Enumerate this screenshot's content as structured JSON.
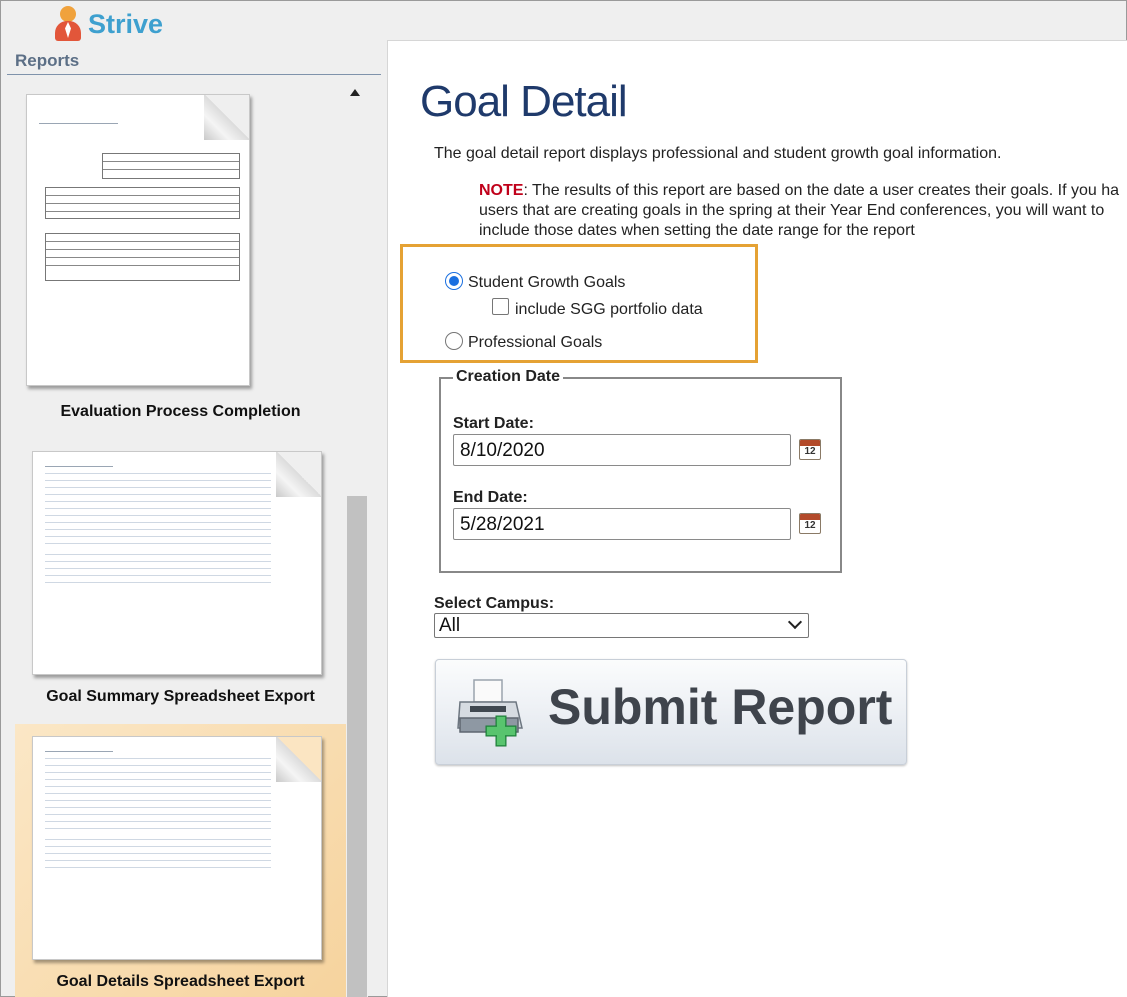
{
  "brand": {
    "name": "Strive"
  },
  "sidebar": {
    "title": "Reports",
    "reports": [
      {
        "label": "Evaluation Process Completion",
        "selected": false
      },
      {
        "label": "Goal Summary Spreadsheet Export",
        "selected": false
      },
      {
        "label": "Goal Details Spreadsheet Export",
        "selected": true
      }
    ]
  },
  "main": {
    "title": "Goal Detail",
    "description": "The goal detail report displays professional and student growth goal information.",
    "note": {
      "label": "NOTE",
      "lines": [
        ": The results of this report are based on the date a user creates their goals. If you ha",
        "users that are creating goals in the spring at their Year End conferences, you will want to",
        "include those dates when setting the date range for the report"
      ]
    },
    "goal_options": {
      "student_growth": "Student Growth Goals",
      "include_portfolio": "include SGG portfolio data",
      "professional": "Professional Goals",
      "selected": "student_growth",
      "include_portfolio_checked": false
    },
    "creation_date": {
      "legend": "Creation Date",
      "start_label": "Start Date:",
      "start_value": "8/10/2020",
      "end_label": "End Date:",
      "end_value": "5/28/2021",
      "calendar_day": "12"
    },
    "campus": {
      "label": "Select Campus:",
      "selected": "All"
    },
    "submit": {
      "label": "Submit Report"
    }
  },
  "colors": {
    "title": "#1f3a6b",
    "brand": "#3ea0cf",
    "note_label": "#c0001a",
    "highlight_border": "#e5a234",
    "selected_report_bg": "#f6d39d"
  }
}
